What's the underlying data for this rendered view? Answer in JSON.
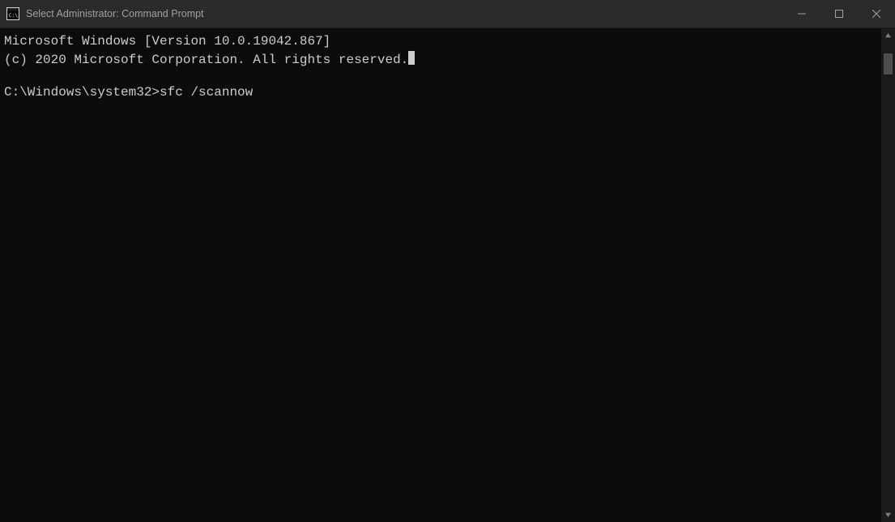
{
  "window": {
    "title": "Select Administrator: Command Prompt"
  },
  "terminal": {
    "header_line_1": "Microsoft Windows [Version 10.0.19042.867]",
    "header_line_2": "(c) 2020 Microsoft Corporation. All rights reserved.",
    "prompt": "C:\\Windows\\system32>",
    "command": "sfc /scannow"
  }
}
